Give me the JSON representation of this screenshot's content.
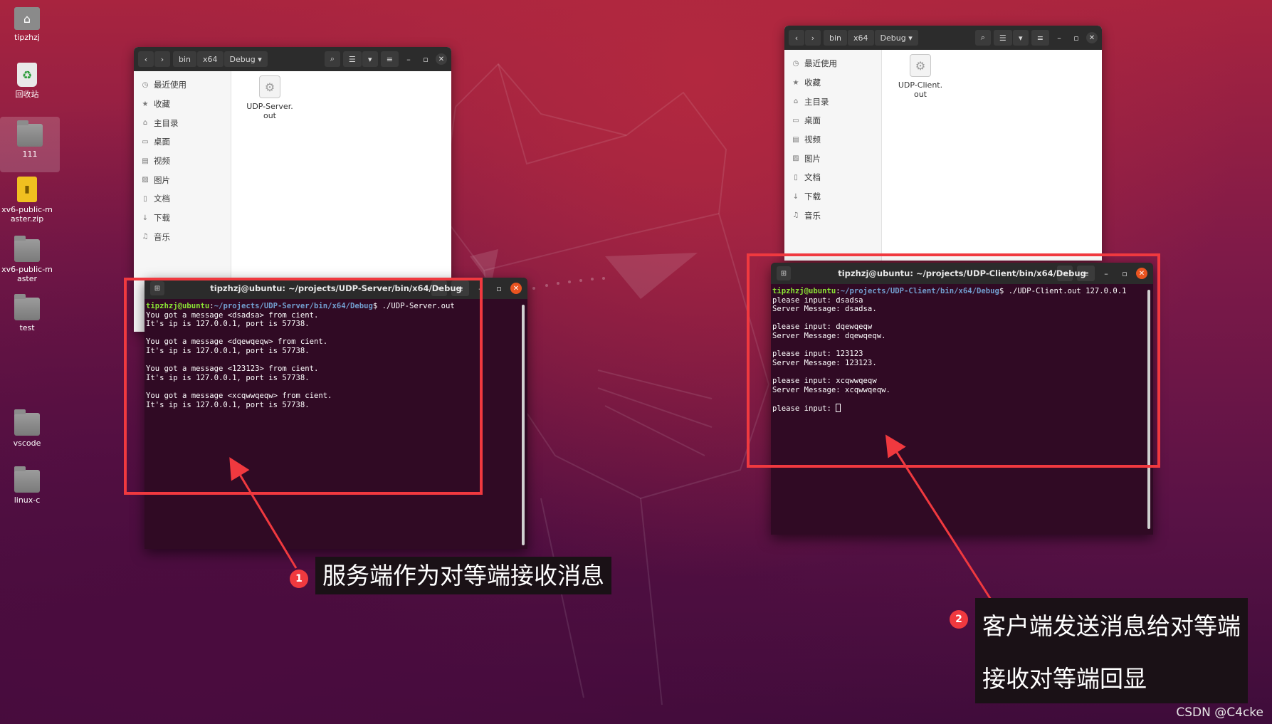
{
  "desktop": {
    "icons": [
      {
        "label": "tipzhzj",
        "icon": "home-folder-icon"
      },
      {
        "label": "回收站",
        "icon": "trash-icon"
      },
      {
        "label": "111",
        "icon": "folder-icon"
      },
      {
        "label": "xv6-public-master.zip",
        "icon": "zip-archive-icon"
      },
      {
        "label": "xv6-public-master",
        "icon": "folder-icon"
      },
      {
        "label": "test",
        "icon": "folder-icon"
      },
      {
        "label": "vscode",
        "icon": "folder-icon"
      },
      {
        "label": "linux-c",
        "icon": "folder-icon"
      }
    ]
  },
  "file_manager_server": {
    "breadcrumb": [
      "bin",
      "x64",
      "Debug"
    ],
    "sidebar": [
      "最近使用",
      "收藏",
      "主目录",
      "桌面",
      "视频",
      "图片",
      "文档",
      "下载",
      "音乐"
    ],
    "file": {
      "name": "UDP-Server.out",
      "line1": "UDP-Server.",
      "line2": "out"
    }
  },
  "file_manager_client": {
    "breadcrumb": [
      "bin",
      "x64",
      "Debug"
    ],
    "sidebar": [
      "最近使用",
      "收藏",
      "主目录",
      "桌面",
      "视频",
      "图片",
      "文档",
      "下载",
      "音乐"
    ],
    "file": {
      "name": "UDP-Client.out",
      "line1": "UDP-Client.",
      "line2": "out"
    }
  },
  "terminal_server": {
    "title": "tipzhzj@ubuntu: ~/projects/UDP-Server/bin/x64/Debug",
    "prompt_user": "tipzhzj@ubuntu",
    "prompt_path": "~/projects/UDP-Server/bin/x64/Debug",
    "command": "$ ./UDP-Server.out",
    "lines": [
      "You got a message <dsadsa> from cient.",
      "It's ip is 127.0.0.1, port is 57738.",
      "",
      "You got a message <dqewqeqw> from cient.",
      "It's ip is 127.0.0.1, port is 57738.",
      "",
      "You got a message <123123> from cient.",
      "It's ip is 127.0.0.1, port is 57738.",
      "",
      "You got a message <xcqwwqeqw> from cient.",
      "It's ip is 127.0.0.1, port is 57738."
    ]
  },
  "terminal_client": {
    "title": "tipzhzj@ubuntu: ~/projects/UDP-Client/bin/x64/Debug",
    "prompt_user": "tipzhzj@ubuntu",
    "prompt_path": "~/projects/UDP-Client/bin/x64/Debug",
    "command": "$ ./UDP-Client.out 127.0.0.1",
    "lines": [
      "please input: dsadsa",
      "Server Message: dsadsa.",
      "",
      "please input: dqewqeqw",
      "Server Message: dqewqeqw.",
      "",
      "please input: 123123",
      "Server Message: 123123.",
      "",
      "please input: xcqwwqeqw",
      "Server Message: xcqwwqeqw.",
      ""
    ],
    "last_prompt": "please input: "
  },
  "annotations": {
    "note1_number": "1",
    "note1_text": "服务端作为对等端接收消息",
    "note2_number": "2",
    "note2_line1": "客户端发送消息给对等端",
    "note2_line2": "接收对等端回显",
    "accent_color": "#f0393f"
  },
  "watermark": "CSDN @C4cke"
}
